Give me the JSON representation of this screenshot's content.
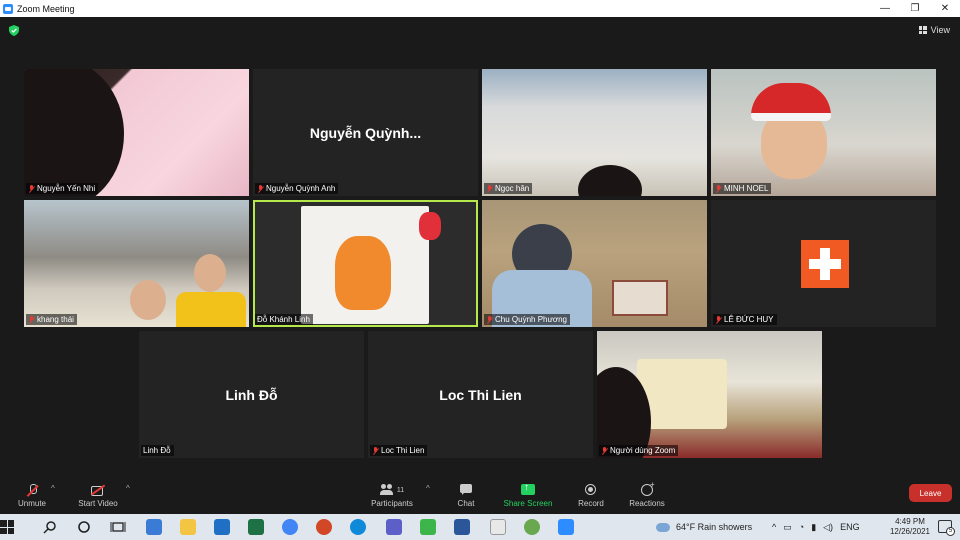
{
  "window": {
    "title": "Zoom Meeting",
    "controls": [
      "—",
      "❐",
      "✕"
    ]
  },
  "header": {
    "view_label": "View"
  },
  "tiles": [
    {
      "name": "Nguyễn Yến Nhi",
      "muted": true
    },
    {
      "name": "Nguyễn Quỳnh Anh",
      "center_label": "Nguyễn  Quỳnh...",
      "muted": true
    },
    {
      "name": "Ngọc hân",
      "muted": true
    },
    {
      "name": "MINH NOEL",
      "muted": true
    },
    {
      "name": "khang thái",
      "muted": true
    },
    {
      "name": "Đỗ Khánh Linh",
      "muted": false,
      "active_speaker": true
    },
    {
      "name": "Chu Quỳnh Phương",
      "muted": true
    },
    {
      "name": "LÊ ĐỨC HUY",
      "muted": true
    },
    {
      "name": "Linh Đỗ",
      "center_label": "Linh Đỗ",
      "muted": false
    },
    {
      "name": "Loc Thi Lien",
      "center_label": "Loc Thi Lien",
      "muted": true
    },
    {
      "name": "Người dùng Zoom",
      "muted": true
    }
  ],
  "toolbar": {
    "unmute": "Unmute",
    "start_video": "Start Video",
    "participants": "Participants",
    "participants_count": "11",
    "chat": "Chat",
    "share_screen": "Share Screen",
    "record": "Record",
    "reactions": "Reactions",
    "leave": "Leave"
  },
  "taskbar": {
    "weather": "64°F  Rain showers",
    "language": "ENG",
    "time": "4:49 PM",
    "date": "12/26/2021",
    "notifications": "5"
  },
  "colors": {
    "accent_green": "#23d160",
    "leave_red": "#c8302b",
    "active_border": "#b5e84a",
    "mute_red": "#e53935"
  }
}
